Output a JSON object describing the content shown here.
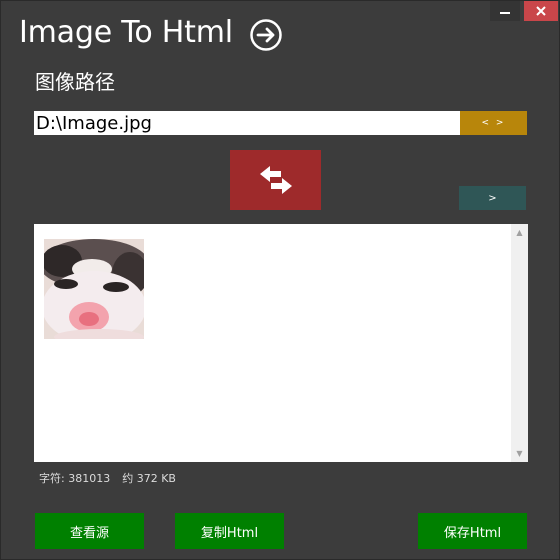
{
  "window": {
    "title": "Image To Html",
    "title_icon": "arrow-right-circle-icon",
    "minimize_icon": "minimize-icon",
    "close_icon": "close-icon"
  },
  "path": {
    "label": "图像路径",
    "value": "D:\\Image.jpg",
    "browse_label": "< >"
  },
  "convert_icon": "swap-arrows-icon",
  "next_label": ">",
  "preview": {
    "image_icon": "puppy-thumbnail"
  },
  "status": {
    "chars": "字符: 381013",
    "size": "约 372 KB"
  },
  "actions": {
    "view_source": "查看源",
    "copy_html": "复制Html",
    "save_html": "保存Html"
  },
  "colors": {
    "background": "#3c3c3c",
    "browse": "#b8860b",
    "convert": "#9e2a2b",
    "next": "#2f5656",
    "action": "#008000",
    "close": "#c9464a"
  }
}
